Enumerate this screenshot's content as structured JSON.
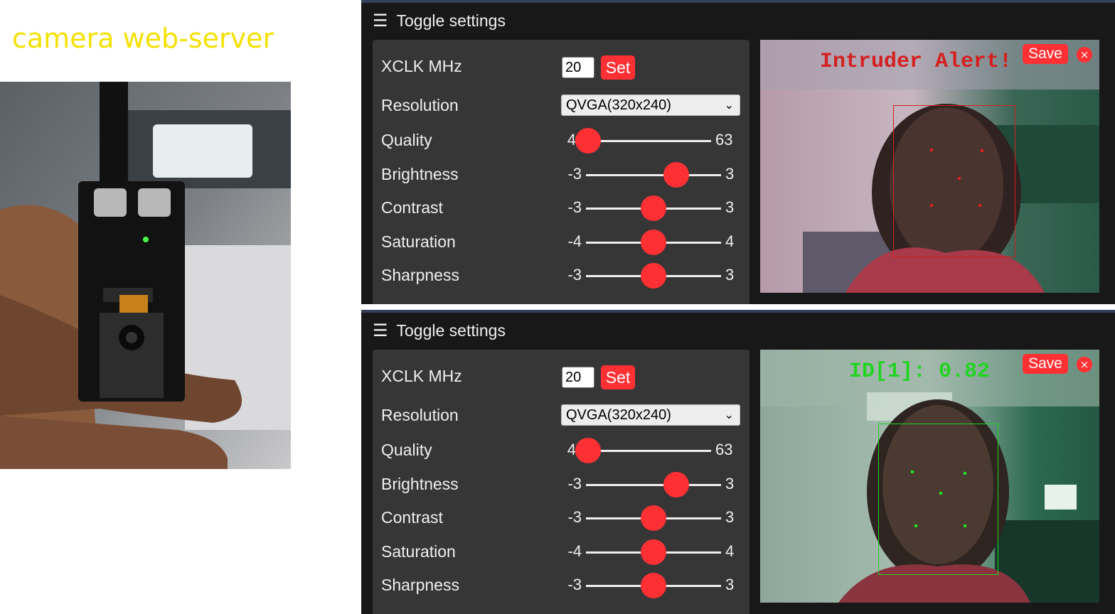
{
  "caption": "camera web-server",
  "panels": [
    {
      "toggle_label": "Toggle settings",
      "xclk": {
        "label": "XCLK MHz",
        "value": "20",
        "set_label": "Set"
      },
      "resolution": {
        "label": "Resolution",
        "selected": "QVGA(320x240)"
      },
      "sliders": [
        {
          "label": "Quality",
          "min": "4",
          "max": "63",
          "fraction": 0.06
        },
        {
          "label": "Brightness",
          "min": "-3",
          "max": "3",
          "fraction": 0.67
        },
        {
          "label": "Contrast",
          "min": "-3",
          "max": "3",
          "fraction": 0.5
        },
        {
          "label": "Saturation",
          "min": "-4",
          "max": "4",
          "fraction": 0.5
        },
        {
          "label": "Sharpness",
          "min": "-3",
          "max": "3",
          "fraction": 0.5
        }
      ],
      "camera": {
        "overlay_text": "Intruder Alert!",
        "overlay_color": "#d42020",
        "box_color": "#d42020",
        "landmark_color": "#e02020"
      },
      "save_label": "Save",
      "close_icon": "×"
    },
    {
      "toggle_label": "Toggle settings",
      "xclk": {
        "label": "XCLK MHz",
        "value": "20",
        "set_label": "Set"
      },
      "resolution": {
        "label": "Resolution",
        "selected": "QVGA(320x240)"
      },
      "sliders": [
        {
          "label": "Quality",
          "min": "4",
          "max": "63",
          "fraction": 0.06
        },
        {
          "label": "Brightness",
          "min": "-3",
          "max": "3",
          "fraction": 0.67
        },
        {
          "label": "Contrast",
          "min": "-3",
          "max": "3",
          "fraction": 0.5
        },
        {
          "label": "Saturation",
          "min": "-4",
          "max": "4",
          "fraction": 0.5
        },
        {
          "label": "Sharpness",
          "min": "-3",
          "max": "3",
          "fraction": 0.5
        }
      ],
      "camera": {
        "overlay_text": "ID[1]: 0.82",
        "overlay_color": "#22d422",
        "box_color": "#22d422",
        "landmark_color": "#22e022"
      },
      "save_label": "Save",
      "close_icon": "×"
    }
  ],
  "colors": {
    "accent": "#ff3034",
    "panel_bg": "#363636",
    "page_bg": "#181818",
    "caption": "#f5e100"
  }
}
